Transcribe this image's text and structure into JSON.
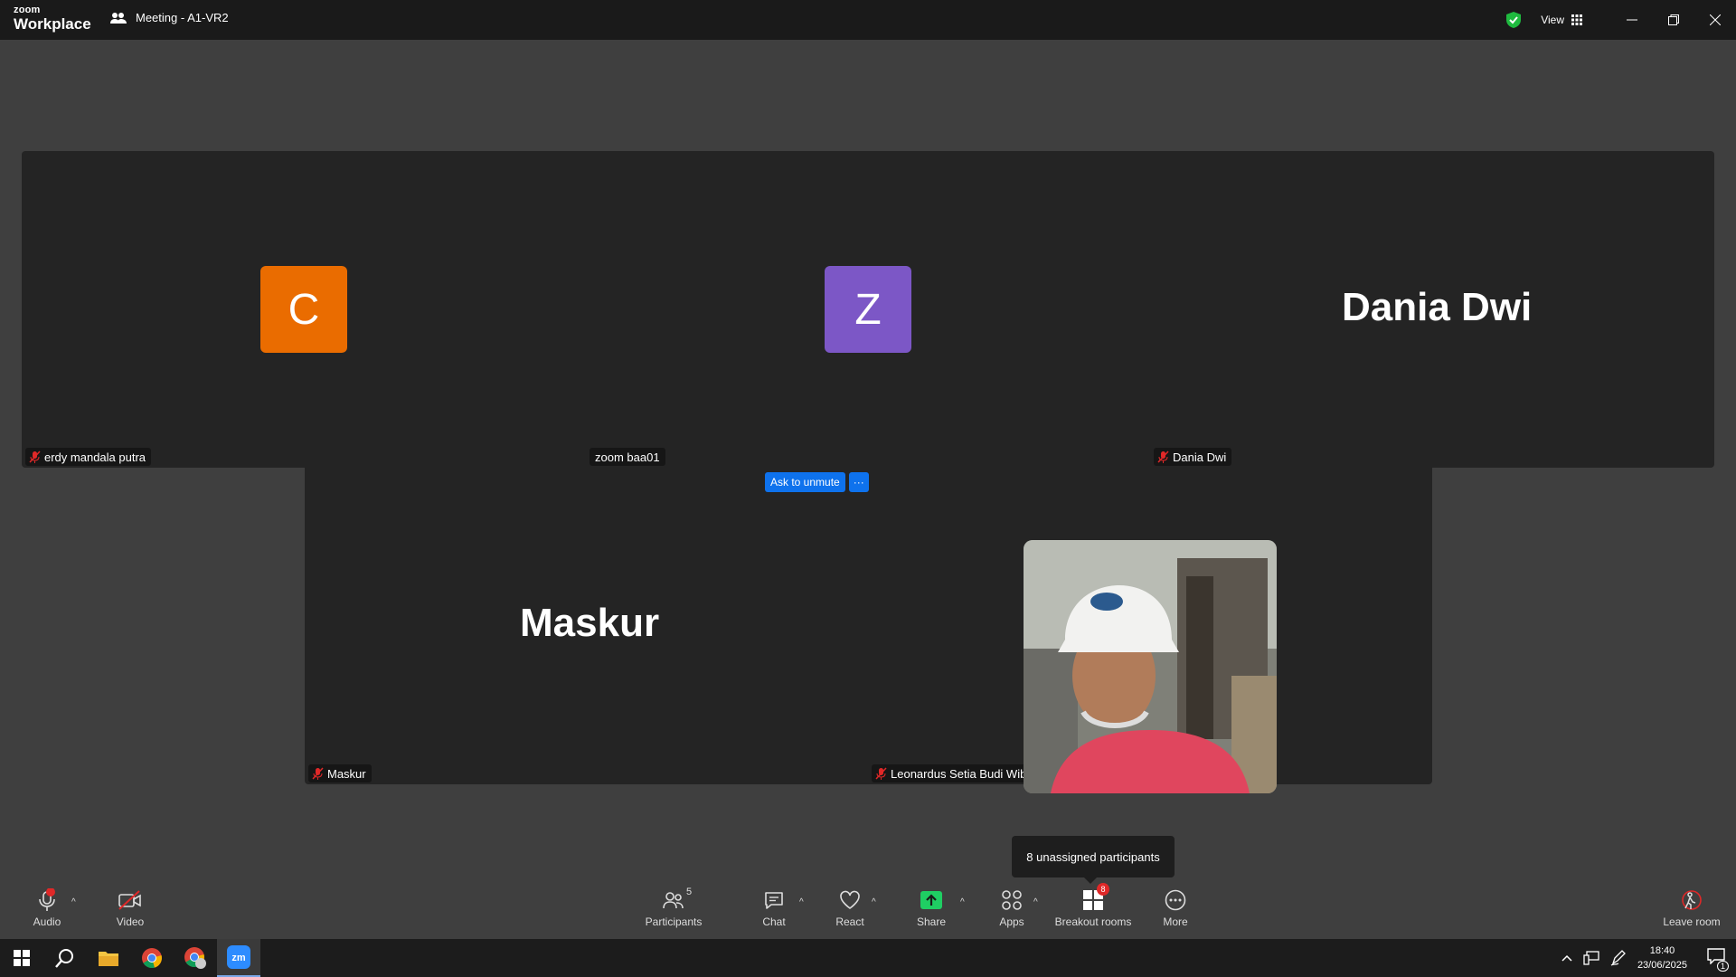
{
  "app": {
    "logo_line1": "zoom",
    "logo_line2": "Workplace",
    "meeting_title": "Meeting - A1-VR2",
    "view_label": "View"
  },
  "colors": {
    "avatar_c": "#ea6c00",
    "avatar_z": "#7c57c6",
    "accent": "#0e72ed",
    "mute_red": "#e02828",
    "share_green": "#1fce63",
    "shield_green": "#1fba3f"
  },
  "tiles": [
    {
      "initial": "C",
      "label": "erdy mandala putra",
      "muted": true
    },
    {
      "initial": "Z",
      "label": "zoom baa01",
      "muted": false
    },
    {
      "big_name": "Dania Dwi",
      "label": "Dania Dwi",
      "muted": true
    },
    {
      "big_name": "Maskur",
      "label": "Maskur",
      "muted": true
    },
    {
      "video": "participant camera",
      "label": "Leonardus Setia Budi Wibowo",
      "muted": true
    }
  ],
  "ask_unmute": {
    "label": "Ask to unmute",
    "more": "···"
  },
  "tooltip": "8 unassigned participants",
  "toolbar": {
    "audio": "Audio",
    "video": "Video",
    "participants": "Participants",
    "participants_count": "5",
    "chat": "Chat",
    "react": "React",
    "share": "Share",
    "apps": "Apps",
    "breakout": "Breakout rooms",
    "breakout_badge": "8",
    "more": "More",
    "leave": "Leave room"
  },
  "taskbar": {
    "time": "18:40",
    "date": "23/06/2025",
    "notif_count": "1"
  }
}
